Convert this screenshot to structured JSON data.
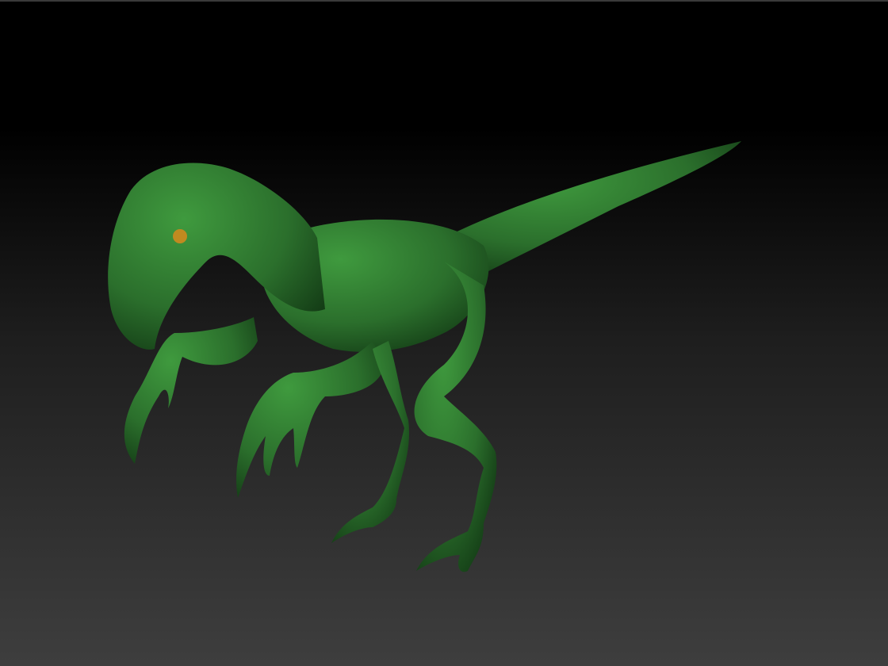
{
  "viewport": {
    "background_top": "#000000",
    "background_bottom": "#3e3e3e",
    "model_color": "#2f7a30",
    "model_shadow": "#123a14",
    "eye_color": "#c08a20"
  }
}
